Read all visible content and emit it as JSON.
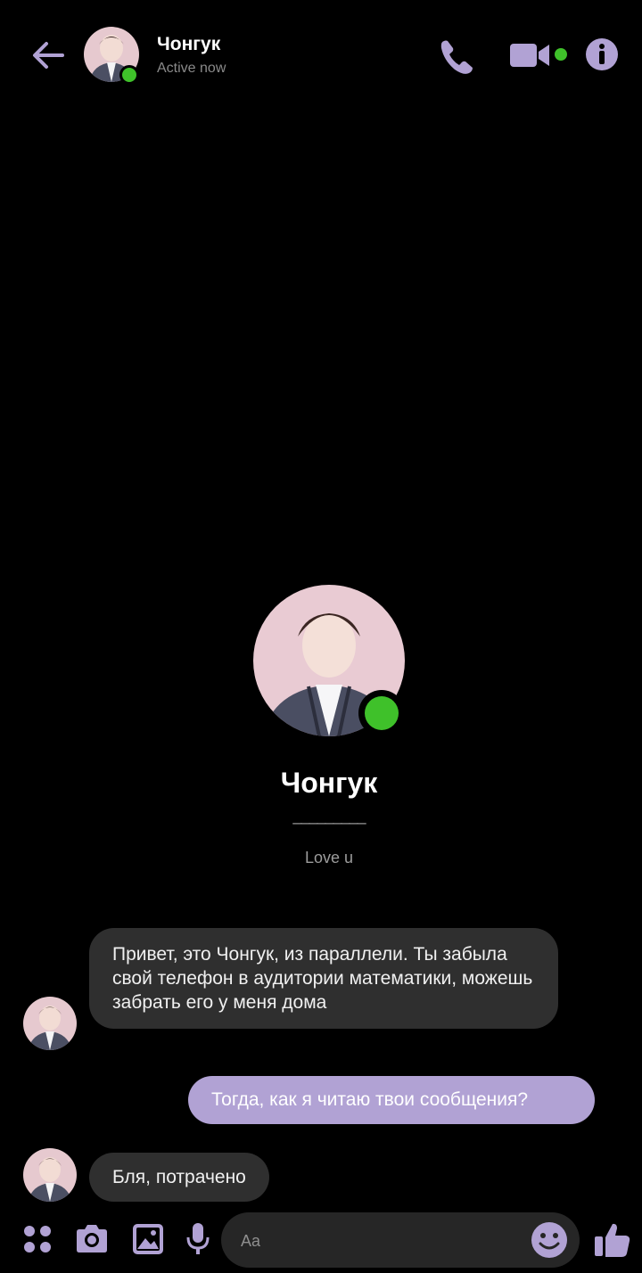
{
  "header": {
    "contact_name": "Чонгук",
    "status": "Active now",
    "icons": {
      "back": "arrow-left-icon",
      "call": "phone-icon",
      "video": "video-camera-icon",
      "info": "info-icon"
    }
  },
  "profile": {
    "name": "Чонгук",
    "divider": "_________",
    "bio": "Love u",
    "online": true
  },
  "messages": [
    {
      "direction": "incoming",
      "text": "Привет, это Чонгук, из параллели. Ты забыла свой телефон в аудитории математики, можешь забрать его у меня дома"
    },
    {
      "direction": "outgoing",
      "text": "Тогда, как я читаю твои сообщения?"
    },
    {
      "direction": "incoming",
      "text": "Бля, потрачено"
    }
  ],
  "composer": {
    "placeholder": "Aa",
    "icons": [
      "apps-grid-icon",
      "camera-icon",
      "image-icon",
      "microphone-icon",
      "emoji-icon",
      "thumbs-up-icon"
    ]
  },
  "colors": {
    "accent": "#b1a2d4",
    "online": "#3fc12a",
    "incoming_bubble": "#2f2f2f",
    "background": "#000000"
  }
}
